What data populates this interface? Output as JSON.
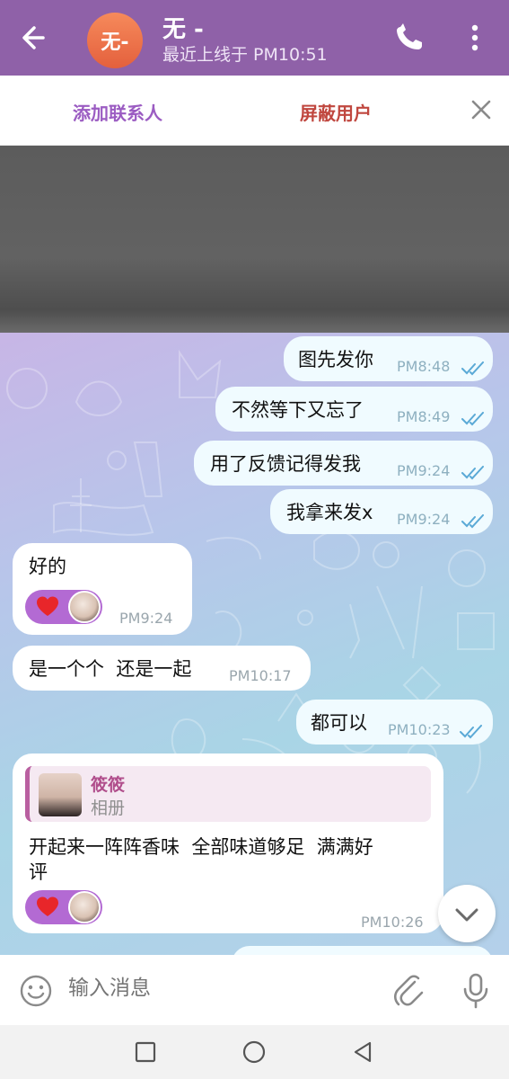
{
  "header": {
    "avatar_text": "无-",
    "title": "无 -",
    "subtitle": "最近上线于 PM10:51"
  },
  "actions": {
    "add_contact": "添加联系人",
    "block_user": "屏蔽用户"
  },
  "messages": [
    {
      "direction": "out",
      "text": "图先发你",
      "time": "PM8:48",
      "status": "read"
    },
    {
      "direction": "out",
      "text": "不然等下又忘了",
      "time": "PM8:49",
      "status": "read"
    },
    {
      "direction": "out",
      "text": "用了反馈记得发我",
      "time": "PM9:24",
      "status": "read"
    },
    {
      "direction": "out",
      "text": "我拿来发x",
      "time": "PM9:24",
      "status": "read"
    },
    {
      "direction": "in",
      "text": "好的",
      "time": "PM9:24",
      "reaction": "heart"
    },
    {
      "direction": "in",
      "text": "是一个个  还是一起",
      "time": "PM10:17"
    },
    {
      "direction": "out",
      "text": "都可以",
      "time": "PM10:23",
      "status": "read"
    },
    {
      "direction": "in",
      "reply_to": {
        "name": "筱筱",
        "type": "相册"
      },
      "text_line1": "开起来一阵阵香味  全部味道够足  满满好",
      "text_line2": "评",
      "time": "PM10:26",
      "reaction": "heart"
    }
  ],
  "composer": {
    "placeholder": "输入消息"
  },
  "colors": {
    "header_bg": "#8f61a8",
    "add_contact": "#9b5cc2",
    "block_user": "#c0473f",
    "read_ticks": "#5aa9d6",
    "reaction_bg": "#b36ad3"
  }
}
